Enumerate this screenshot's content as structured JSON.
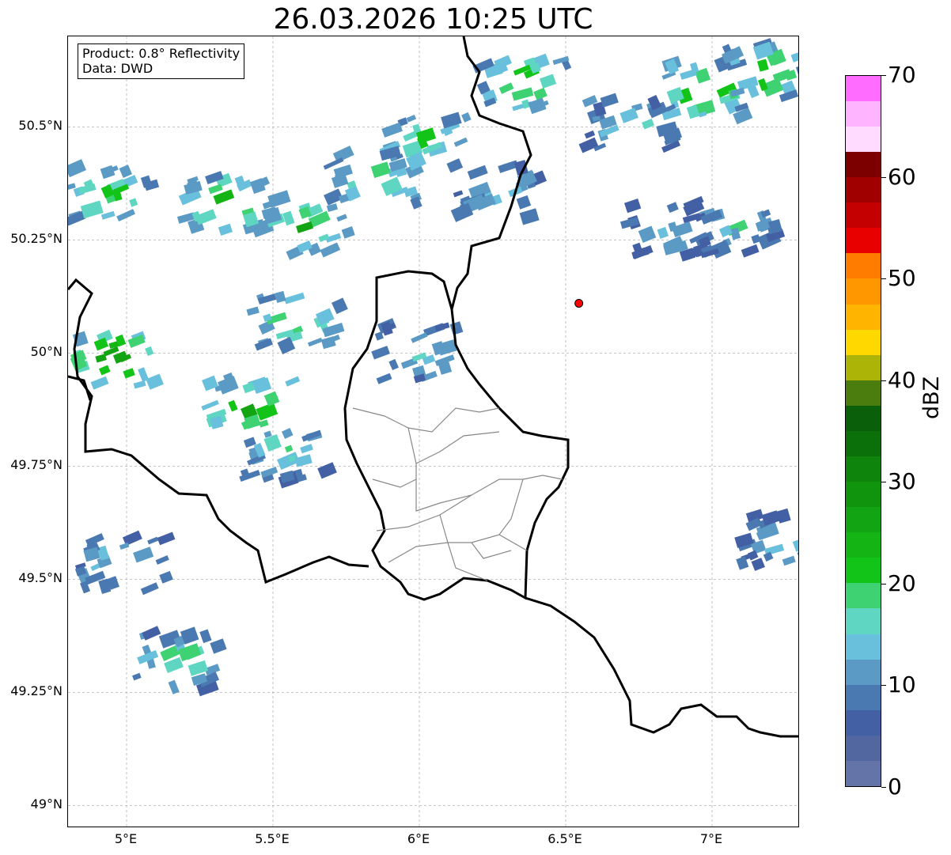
{
  "title": "26.03.2026 10:25 UTC",
  "info": {
    "product": "Product: 0.8° Reflectivity",
    "source": "Data: DWD"
  },
  "axes": {
    "lat_ticks": [
      "50.5°N",
      "50.25°N",
      "50°N",
      "49.75°N",
      "49.5°N",
      "49.25°N",
      "49°N"
    ],
    "lon_ticks": [
      "5°E",
      "5.5°E",
      "6°E",
      "6.5°E",
      "7°E"
    ]
  },
  "extent": {
    "lon_min": 4.8,
    "lon_max": 7.3,
    "lat_min": 48.95,
    "lat_max": 50.7
  },
  "marker": {
    "lon": 6.545,
    "lat": 50.11,
    "color": "#ff0000"
  },
  "colorbar": {
    "label": "dBZ",
    "ticks": [
      "0",
      "10",
      "20",
      "30",
      "40",
      "50",
      "60",
      "70"
    ],
    "vmin": 0,
    "vmax": 70,
    "step": 2.5,
    "colors": [
      "#6574a8",
      "#5266a0",
      "#4460a4",
      "#4a78b0",
      "#5a9ac4",
      "#68c0dc",
      "#5ed6c2",
      "#3ed272",
      "#12c418",
      "#14b414",
      "#12a412",
      "#10940e",
      "#0e840c",
      "#0c700a",
      "#0a600a",
      "#4a7c0e",
      "#acb408",
      "#ffd800",
      "#ffb400",
      "#ff9800",
      "#ff7c00",
      "#e80000",
      "#c40000",
      "#a00000",
      "#7c0000",
      "#ffdcff",
      "#ffb4ff",
      "#ff6cff"
    ]
  },
  "rain_cells": [
    {
      "lon": 4.95,
      "lat": 50.35,
      "dBZ": 22
    },
    {
      "lon": 5.35,
      "lat": 50.33,
      "dBZ": 26
    },
    {
      "lon": 5.62,
      "lat": 50.28,
      "dBZ": 24
    },
    {
      "lon": 5.85,
      "lat": 50.38,
      "dBZ": 22
    },
    {
      "lon": 6.02,
      "lat": 50.47,
      "dBZ": 20
    },
    {
      "lon": 6.36,
      "lat": 50.6,
      "dBZ": 24
    },
    {
      "lon": 6.98,
      "lat": 50.58,
      "dBZ": 26
    },
    {
      "lon": 7.18,
      "lat": 50.62,
      "dBZ": 24
    },
    {
      "lon": 6.72,
      "lat": 50.5,
      "dBZ": 18
    },
    {
      "lon": 4.95,
      "lat": 49.99,
      "dBZ": 30
    },
    {
      "lon": 5.42,
      "lat": 49.88,
      "dBZ": 26
    },
    {
      "lon": 5.58,
      "lat": 50.07,
      "dBZ": 22
    },
    {
      "lon": 6.0,
      "lat": 50.0,
      "dBZ": 16
    },
    {
      "lon": 4.99,
      "lat": 49.53,
      "dBZ": 18
    },
    {
      "lon": 5.18,
      "lat": 49.32,
      "dBZ": 20
    },
    {
      "lon": 5.55,
      "lat": 49.78,
      "dBZ": 18
    },
    {
      "lon": 7.08,
      "lat": 50.28,
      "dBZ": 16
    },
    {
      "lon": 6.86,
      "lat": 50.27,
      "dBZ": 14
    },
    {
      "lon": 7.25,
      "lat": 49.58,
      "dBZ": 14
    },
    {
      "lon": 6.27,
      "lat": 50.36,
      "dBZ": 16
    }
  ]
}
